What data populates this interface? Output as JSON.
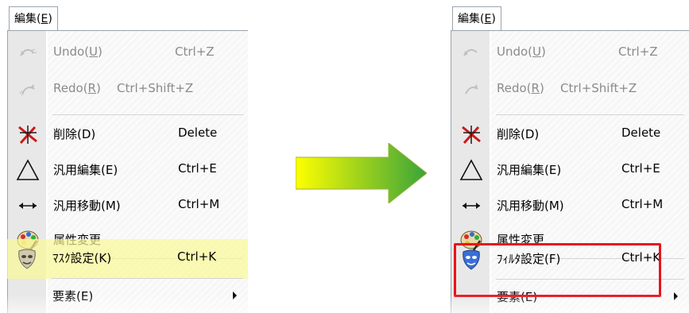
{
  "left_menu": {
    "menu_title": "編集(E)",
    "items": [
      {
        "icon": "undo-icon",
        "label": "Undo(U)",
        "shortcut": "Ctrl+Z",
        "disabled": true
      },
      {
        "icon": "redo-icon",
        "label": "Redo(R)",
        "shortcut": "Ctrl+Shift+Z",
        "disabled": true
      },
      {
        "icon": "delete-icon",
        "label": "削除(D)",
        "shortcut": "Delete",
        "disabled": false
      },
      {
        "icon": "triangle-edit-icon",
        "label": "汎用編集(E)",
        "shortcut": "Ctrl+E",
        "disabled": false
      },
      {
        "icon": "move-arrows-icon",
        "label": "汎用移動(M)",
        "shortcut": "Ctrl+M",
        "disabled": false
      },
      {
        "icon": "palette-icon",
        "label": "属性変更",
        "shortcut": "",
        "disabled": false
      },
      {
        "icon": "mask-icon",
        "label": "ﾏｽｸ設定(K)",
        "shortcut": "Ctrl+K",
        "disabled": false
      },
      {
        "icon": "",
        "label": "要素(E)",
        "shortcut": "",
        "disabled": false
      }
    ]
  },
  "right_menu": {
    "menu_title": "編集(E)",
    "items": [
      {
        "icon": "undo-icon",
        "label": "Undo(U)",
        "shortcut": "Ctrl+Z",
        "disabled": true
      },
      {
        "icon": "redo-icon",
        "label": "Redo(R)",
        "shortcut": "Ctrl+Shift+Z",
        "disabled": true
      },
      {
        "icon": "delete-icon",
        "label": "削除(D)",
        "shortcut": "Delete",
        "disabled": false
      },
      {
        "icon": "triangle-edit-icon",
        "label": "汎用編集(E)",
        "shortcut": "Ctrl+E",
        "disabled": false
      },
      {
        "icon": "move-arrows-icon",
        "label": "汎用移動(M)",
        "shortcut": "Ctrl+M",
        "disabled": false
      },
      {
        "icon": "palette-icon",
        "label": "属性変更",
        "shortcut": "",
        "disabled": false
      },
      {
        "icon": "mask-icon",
        "label": "ﾌｨﾙﾀ設定(F)",
        "shortcut": "Ctrl+K",
        "disabled": false
      },
      {
        "icon": "",
        "label": "要素(E)",
        "shortcut": "",
        "disabled": false
      }
    ]
  },
  "colors": {
    "highlight_yellow": "#fafa96",
    "red_box": "#e8141b",
    "arrow_start": "#ffff00",
    "arrow_end": "#3aa43a"
  }
}
